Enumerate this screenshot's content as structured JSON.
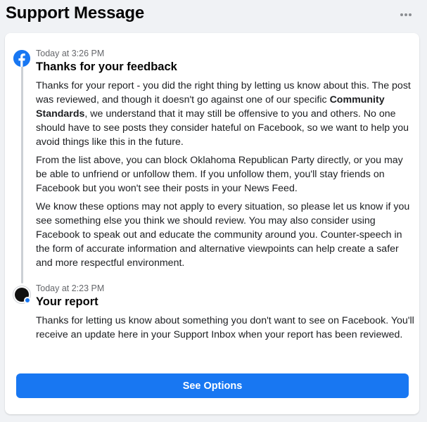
{
  "header": {
    "title": "Support Message",
    "more_icon": "more-horizontal-icon"
  },
  "messages": [
    {
      "icon": "facebook-logo-icon",
      "time": "Today at 3:26 PM",
      "title": "Thanks for your feedback",
      "paragraphs": {
        "p1_before": "Thanks for your report - you did the right thing by letting us know about this. The post was reviewed, and though it doesn't go against one of our specific ",
        "p1_bold": "Community Standards",
        "p1_after": ", we understand that it may still be offensive to you and others. No one should have to see posts they consider hateful on Facebook, so we want to help you avoid things like this in the future.",
        "p2": "From the list above, you can block Oklahoma Republican Party directly, or you may be able to unfriend or unfollow them. If you unfollow them, you'll stay friends on Facebook but you won't see their posts in your News Feed.",
        "p3": "We know these options may not apply to every situation, so please let us know if you see something else you think we should review. You may also consider using Facebook to speak out and educate the community around you. Counter-speech in the form of accurate information and alternative viewpoints can help create a safer and more respectful environment."
      }
    },
    {
      "icon": "user-avatar-icon",
      "time": "Today at 2:23 PM",
      "title": "Your report",
      "paragraphs": {
        "p1": "Thanks for letting us know about something you don't want to see on Facebook. You'll receive an update here in your Support Inbox when your report has been reviewed."
      }
    }
  ],
  "actions": {
    "see_options_label": "See Options"
  },
  "colors": {
    "accent": "#1877f2",
    "background": "#f0f2f5",
    "secondary_text": "#65676b"
  }
}
